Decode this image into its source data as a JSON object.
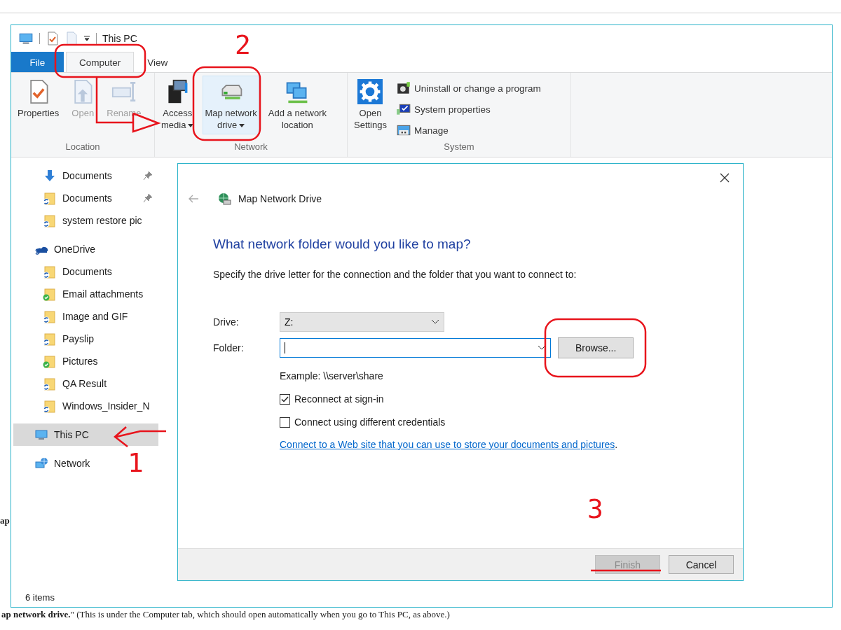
{
  "window": {
    "title": "This PC"
  },
  "ribbon_tabs": [
    {
      "label": "File",
      "kind": "file",
      "selected": false
    },
    {
      "label": "Computer",
      "kind": "tab",
      "selected": true
    },
    {
      "label": "View",
      "kind": "tab",
      "selected": false
    }
  ],
  "ribbon_groups": [
    {
      "label": "Location",
      "buttons": [
        {
          "label": "Properties",
          "kind": "properties",
          "disabled": false,
          "dropdown": false,
          "highlighted": false
        },
        {
          "label": "Open",
          "kind": "open",
          "disabled": true,
          "dropdown": false,
          "highlighted": false
        },
        {
          "label": "Rename",
          "kind": "rename",
          "disabled": true,
          "dropdown": false,
          "highlighted": false
        }
      ]
    },
    {
      "label": "Network",
      "buttons": [
        {
          "label": "Access\nmedia",
          "kind": "media",
          "disabled": false,
          "dropdown": true,
          "highlighted": false
        },
        {
          "label": "Map network\ndrive",
          "kind": "drive",
          "disabled": false,
          "dropdown": true,
          "highlighted": true
        },
        {
          "label": "Add a network\nlocation",
          "kind": "netloc",
          "disabled": false,
          "dropdown": false,
          "highlighted": false
        }
      ]
    },
    {
      "label": "System",
      "buttons": [
        {
          "label": "Open\nSettings",
          "kind": "settings",
          "disabled": false,
          "dropdown": false,
          "highlighted": false
        }
      ],
      "small_buttons": [
        {
          "label": "Uninstall or change a program",
          "kind": "uninstall"
        },
        {
          "label": "System properties",
          "kind": "sysprops"
        },
        {
          "label": "Manage",
          "kind": "manage"
        }
      ]
    }
  ],
  "nav": {
    "quick_access": [
      {
        "label": "Documents",
        "kind": "download",
        "pinned": true,
        "selected": false
      },
      {
        "label": "Documents",
        "kind": "sync_folder",
        "pinned": true,
        "selected": false
      },
      {
        "label": "system restore pic",
        "kind": "sync_folder",
        "pinned": false,
        "selected": false
      }
    ],
    "tree": [
      {
        "label": "OneDrive",
        "kind": "onedrive",
        "selected": false,
        "children": [
          {
            "label": "Documents",
            "kind": "sync_folder",
            "selected": false
          },
          {
            "label": "Email attachments",
            "kind": "synced_folder",
            "selected": false
          },
          {
            "label": "Image and GIF",
            "kind": "sync_folder",
            "selected": false
          },
          {
            "label": "Payslip",
            "kind": "sync_folder",
            "selected": false
          },
          {
            "label": "Pictures",
            "kind": "synced_folder",
            "selected": false
          },
          {
            "label": "QA Result",
            "kind": "sync_folder",
            "selected": false
          },
          {
            "label": "Windows_Insider_N",
            "kind": "sync_folder",
            "selected": false
          }
        ]
      },
      {
        "label": "This PC",
        "kind": "pc",
        "selected": true
      },
      {
        "label": "Network",
        "kind": "network",
        "selected": false
      }
    ]
  },
  "status_bar": {
    "text": "6 items"
  },
  "dialog": {
    "title": "Map Network Drive",
    "back_disabled": true,
    "heading": "What network folder would you like to map?",
    "instruction": "Specify the drive letter for the connection and the folder that you want to connect to:",
    "drive": {
      "label": "Drive:",
      "value": "Z:"
    },
    "folder": {
      "label": "Folder:",
      "focused": true
    },
    "browse_button": "Browse...",
    "example": "Example: \\\\server\\share",
    "checkboxes": [
      {
        "label": "Reconnect at sign-in",
        "checked": true
      },
      {
        "label": "Connect using different credentials",
        "checked": false
      }
    ],
    "link": "Connect to a Web site that you can use to store your documents and pictures",
    "link_suffix": ".",
    "buttons": [
      {
        "label": "Finish",
        "disabled": true
      },
      {
        "label": "Cancel",
        "disabled": false
      }
    ]
  },
  "annotations": [
    {
      "text": "2"
    },
    {
      "text": "1"
    },
    {
      "text": "3"
    }
  ],
  "background_text": [
    "ap",
    "**ap network drive.**\" (This is under the Computer tab, which should open automatically when you go to This PC, as above.)"
  ]
}
